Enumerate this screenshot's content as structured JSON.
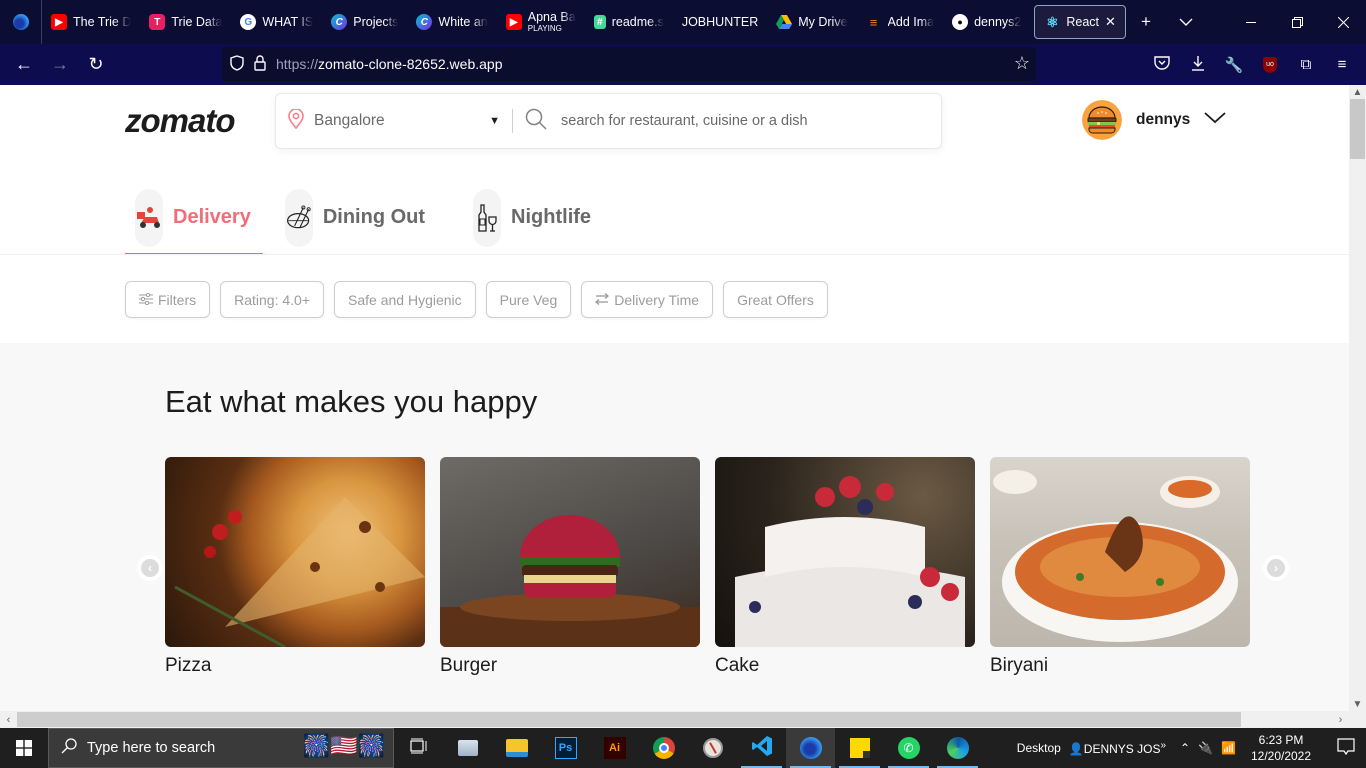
{
  "browser": {
    "tabs": [
      {
        "label": "The Trie D",
        "icon": "youtube-icon",
        "color": "#ff0000"
      },
      {
        "label": "Trie Data",
        "icon": "tumblr-icon",
        "color": "#e91e63"
      },
      {
        "label": "WHAT IS",
        "icon": "google-icon",
        "color": "#ffffff"
      },
      {
        "label": "Projects",
        "icon": "canva-icon",
        "color": "#7d2ae8"
      },
      {
        "label": "White an",
        "icon": "canva-icon",
        "color": "#00c4cc"
      },
      {
        "label": "Apna Ba",
        "sublabel": "PLAYING",
        "icon": "youtube-icon",
        "color": "#ff0000"
      },
      {
        "label": "readme.s",
        "icon": "markdown-icon",
        "color": "#3ddc97"
      },
      {
        "label": "JOBHUNTER",
        "icon": "",
        "color": ""
      },
      {
        "label": "My Drive",
        "icon": "google-drive-icon",
        "color": "#fbbc04"
      },
      {
        "label": "Add Ima",
        "icon": "stackoverflow-icon",
        "color": "#f48024"
      },
      {
        "label": "dennys2",
        "icon": "github-icon",
        "color": "#ffffff"
      },
      {
        "label": "React",
        "icon": "react-icon",
        "color": "#61dafb",
        "active": true
      }
    ],
    "new_tab": "+",
    "list_tabs": "⌄",
    "window": {
      "minimize": "—",
      "restore": "❐",
      "close": "✕"
    },
    "url_scheme": "https://",
    "url_host": "zomato-clone-82652.web.app"
  },
  "site": {
    "logo": "zomato",
    "location": "Bangalore",
    "search_placeholder": "search for restaurant, cuisine or a dish",
    "username": "dennys",
    "brand_color": "#ef6e79",
    "tabs": [
      {
        "label": "Delivery",
        "active": true
      },
      {
        "label": "Dining Out",
        "active": false
      },
      {
        "label": "Nightlife",
        "active": false
      }
    ],
    "filters": [
      {
        "label": "Filters",
        "icon": "sliders-icon"
      },
      {
        "label": "Rating: 4.0+"
      },
      {
        "label": "Safe and Hygienic"
      },
      {
        "label": "Pure Veg"
      },
      {
        "label": "Delivery Time",
        "icon": "swap-icon"
      },
      {
        "label": "Great Offers"
      }
    ],
    "section_title": "Eat what makes you happy",
    "dishes": [
      {
        "name": "Pizza"
      },
      {
        "name": "Burger"
      },
      {
        "name": "Cake"
      },
      {
        "name": "Biryani"
      }
    ]
  },
  "taskbar": {
    "search_placeholder": "Type here to search",
    "desktop_label": "Desktop",
    "user_label": "DENNYS JOS",
    "time": "6:23 PM",
    "date": "12/20/2022"
  }
}
